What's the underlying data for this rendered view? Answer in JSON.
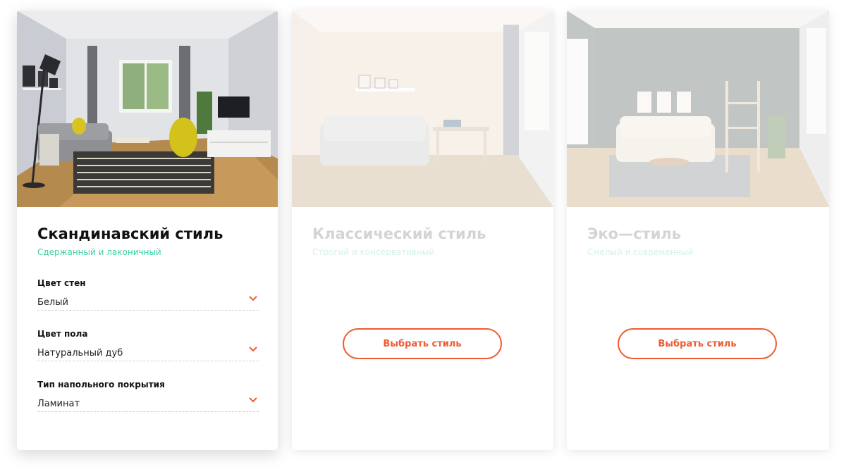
{
  "colors": {
    "accent": "#ef5b33",
    "subtitle_green": "#3fcfa5",
    "title": "#111111"
  },
  "styles": [
    {
      "title": "Скандинавский стиль",
      "subtitle": "Сдержанный и лаконичный",
      "selected": true,
      "fields": [
        {
          "label": "Цвет стен",
          "value": "Белый"
        },
        {
          "label": "Цвет пола",
          "value": "Натуральный дуб"
        },
        {
          "label": "Тип напольного покрытия",
          "value": "Ламинат"
        }
      ]
    },
    {
      "title": "Классический стиль",
      "subtitle": "Строгий и консервативный",
      "selected": false,
      "button_label": "Выбрать стиль"
    },
    {
      "title": "Эко—стиль",
      "subtitle": "Смелый и современный",
      "selected": false,
      "button_label": "Выбрать стиль"
    }
  ]
}
